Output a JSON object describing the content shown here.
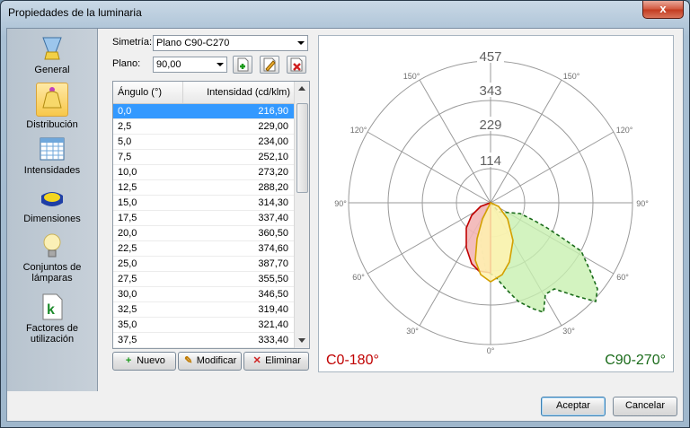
{
  "window": {
    "title": "Propiedades de la luminaria",
    "close_glyph": "x"
  },
  "sidebar": {
    "items": [
      {
        "label": "General",
        "icon": "lamp-general-icon"
      },
      {
        "label": "Distribución",
        "icon": "bell-distribution-icon",
        "active": true
      },
      {
        "label": "Intensidades",
        "icon": "grid-table-icon"
      },
      {
        "label": "Dimensiones",
        "icon": "yellow-panel-icon"
      },
      {
        "label": "Conjuntos de lámparas",
        "icon": "bulb-icon"
      },
      {
        "label": "Factores de utilización",
        "icon": "k-document-icon"
      }
    ]
  },
  "form": {
    "simetria_label": "Simetría:",
    "simetria_value": "Plano C90-C270",
    "plano_label": "Plano:",
    "plano_value": "90,00",
    "tool_buttons": [
      "add-plane-icon",
      "edit-plane-icon",
      "delete-plane-icon"
    ]
  },
  "table": {
    "headers": [
      "Ángulo (°)",
      "Intensidad (cd/klm)"
    ],
    "rows": [
      [
        "0,0",
        "216,90"
      ],
      [
        "2,5",
        "229,00"
      ],
      [
        "5,0",
        "234,00"
      ],
      [
        "7,5",
        "252,10"
      ],
      [
        "10,0",
        "273,20"
      ],
      [
        "12,5",
        "288,20"
      ],
      [
        "15,0",
        "314,30"
      ],
      [
        "17,5",
        "337,40"
      ],
      [
        "20,0",
        "360,50"
      ],
      [
        "22,5",
        "374,60"
      ],
      [
        "25,0",
        "387,70"
      ],
      [
        "27,5",
        "355,50"
      ],
      [
        "30,0",
        "346,50"
      ],
      [
        "32,5",
        "319,40"
      ],
      [
        "35,0",
        "321,40"
      ],
      [
        "37,5",
        "333,40"
      ]
    ],
    "selected_index": 0
  },
  "actions": {
    "nuevo": "Nuevo",
    "modificar": "Modificar",
    "eliminar": "Eliminar"
  },
  "chart": {
    "radial_labels": [
      "457",
      "343",
      "229",
      "114"
    ],
    "angle_labels": [
      "150°",
      "150°",
      "120°",
      "120°",
      "90°",
      "90°",
      "60°",
      "60°",
      "30°",
      "30°",
      "0°"
    ],
    "legend_left": "C0-180°",
    "legend_right": "C90-270°",
    "colors": {
      "c0": "#c00000",
      "c0_fill": "#f2b6b6",
      "c90": "#1a6b1a",
      "c90_fill": "#c8f0b0",
      "inner": "#d4a000",
      "inner_fill": "#fff2b0"
    }
  },
  "footer": {
    "accept": "Aceptar",
    "cancel": "Cancelar"
  }
}
